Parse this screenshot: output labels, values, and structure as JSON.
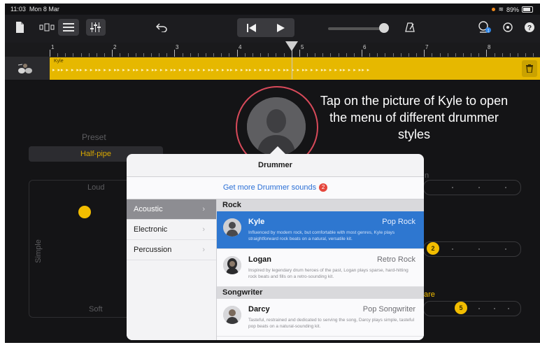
{
  "status_bar": {
    "time": "11:03",
    "date": "Mon 8 Mar",
    "battery": "89%"
  },
  "ruler": {
    "bars": [
      "1",
      "2",
      "3",
      "4",
      "5",
      "6",
      "7",
      "8"
    ]
  },
  "track": {
    "region_name": "Kyle"
  },
  "editor": {
    "preset_label": "Preset",
    "preset_value": "Half-pipe",
    "xy_top": "Loud",
    "xy_bottom": "Soft",
    "xy_left": "Simple",
    "right_partial_label_top": "n",
    "right_partial_label_bottom": "are",
    "knob_values": [
      "2",
      "5"
    ]
  },
  "annotation": "Tap on the picture of Kyle to open the menu of different drummer styles",
  "popover": {
    "title": "Drummer",
    "link": "Get more Drummer sounds",
    "link_badge": "2",
    "categories": [
      {
        "label": "Acoustic",
        "selected": true
      },
      {
        "label": "Electronic",
        "selected": false
      },
      {
        "label": "Percussion",
        "selected": false
      }
    ],
    "sections": [
      {
        "title": "Rock",
        "drummers": [
          {
            "name": "Kyle",
            "style": "Pop Rock",
            "selected": true,
            "description": "Influenced by modern rock, but comfortable with most genres, Kyle plays straightforward rock beats on a natural, versatile kit."
          },
          {
            "name": "Logan",
            "style": "Retro Rock",
            "selected": false,
            "description": "Inspired by legendary drum heroes of the past, Logan plays sparse, hard-hitting rock beats and fills on a retro-sounding kit."
          }
        ]
      },
      {
        "title": "Songwriter",
        "drummers": [
          {
            "name": "Darcy",
            "style": "Pop Songwriter",
            "selected": false,
            "description": "Tasteful, restrained and dedicated to serving the song, Darcy plays simple, tasteful pop beats on a natural-sounding kit."
          }
        ]
      }
    ]
  },
  "colors": {
    "accent_yellow": "#e6b800",
    "selection_blue": "#2e77d0",
    "annotation_red": "#d84a5a",
    "badge_red": "#e5463c"
  },
  "icons": [
    "document-icon",
    "track-view-icon",
    "list-view-icon",
    "mixer-icon",
    "undo-icon",
    "rewind-icon",
    "play-icon",
    "metronome-icon",
    "loops-icon",
    "settings-icon",
    "help-icon",
    "trash-icon"
  ]
}
